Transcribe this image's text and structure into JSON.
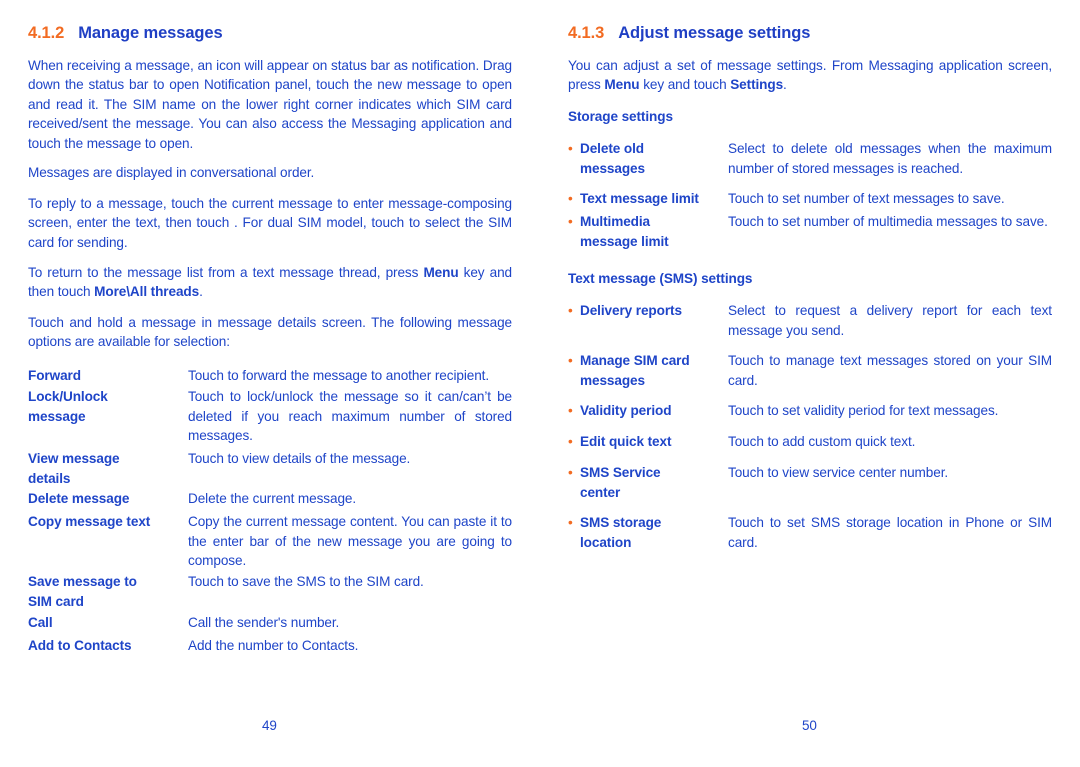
{
  "left": {
    "heading": {
      "number": "4.1.2",
      "title": "Manage messages"
    },
    "p1": "When receiving a message, an icon        will appear on status bar as notification. Drag down the status bar to open Notification panel, touch the new message to open and read it. The SIM name on the lower right corner indicates which SIM card received/sent the message. You can also access the Messaging application and touch the message to open.",
    "p2": "Messages are displayed in conversational order.",
    "p3": "To reply to a message, touch the current message to enter message-composing screen, enter the text, then touch      . For dual SIM model, touch       to select the SIM card for sending.",
    "p4": {
      "a": "To return to the message list from a text message thread, press ",
      "b": "Menu",
      "c": " key and then touch ",
      "d": "More\\All threads",
      "e": "."
    },
    "p5": "Touch and hold a message in message details screen. The following message options are available for selection:",
    "options": [
      {
        "term": "Forward",
        "desc": "Touch to forward the message to another recipient."
      },
      {
        "term": "Lock/Unlock message",
        "desc": "Touch to lock/unlock the message so it can/can’t be deleted if you reach maximum number of stored messages."
      },
      {
        "term": "View message details",
        "desc": "Touch to view details of the message."
      },
      {
        "term": "Delete message",
        "desc": "Delete the current message."
      },
      {
        "term": "Copy message text",
        "desc": "Copy the current message content. You can paste it to the enter bar of the new message you are going to compose."
      },
      {
        "term": "Save message to SIM card",
        "desc": "Touch to save the SMS to the SIM card."
      },
      {
        "term": "Call",
        "desc": "Call the sender's number."
      },
      {
        "term": "Add to Contacts",
        "desc": "Add the number to Contacts."
      }
    ],
    "page_number": "49"
  },
  "right": {
    "heading": {
      "number": "4.1.3",
      "title": "Adjust message settings"
    },
    "intro": {
      "a": "You can adjust a set of message settings. From Messaging application screen, press ",
      "b": "Menu",
      "c": " key and touch ",
      "d": "Settings",
      "e": "."
    },
    "storage_title": "Storage settings",
    "storage": [
      {
        "term": "Delete old messages",
        "desc": "Select to delete old messages when the maximum number of stored messages is reached."
      },
      {
        "term": "Text message limit",
        "desc": "Touch to set number of text messages to save."
      },
      {
        "term": "Multimedia message limit",
        "desc": "Touch to set number of multimedia messages to save."
      }
    ],
    "sms_title": "Text message (SMS) settings",
    "sms": [
      {
        "term": "Delivery reports",
        "desc": "Select to request a delivery report for each text message you send."
      },
      {
        "term": "Manage SIM card messages",
        "desc": "Touch to manage text messages stored on your SIM card."
      },
      {
        "term": "Validity period",
        "desc": "Touch to set validity period for text messages."
      },
      {
        "term": "Edit quick text",
        "desc": "Touch to add custom quick text."
      },
      {
        "term": "SMS Service center",
        "desc": "Touch to view service center number."
      },
      {
        "term": "SMS storage location",
        "desc": "Touch to set SMS storage location in Phone or SIM card."
      }
    ],
    "page_number": "50",
    "bullet": "•"
  },
  "colors": {
    "text": "#1f45c8",
    "accent": "#f26b22"
  }
}
